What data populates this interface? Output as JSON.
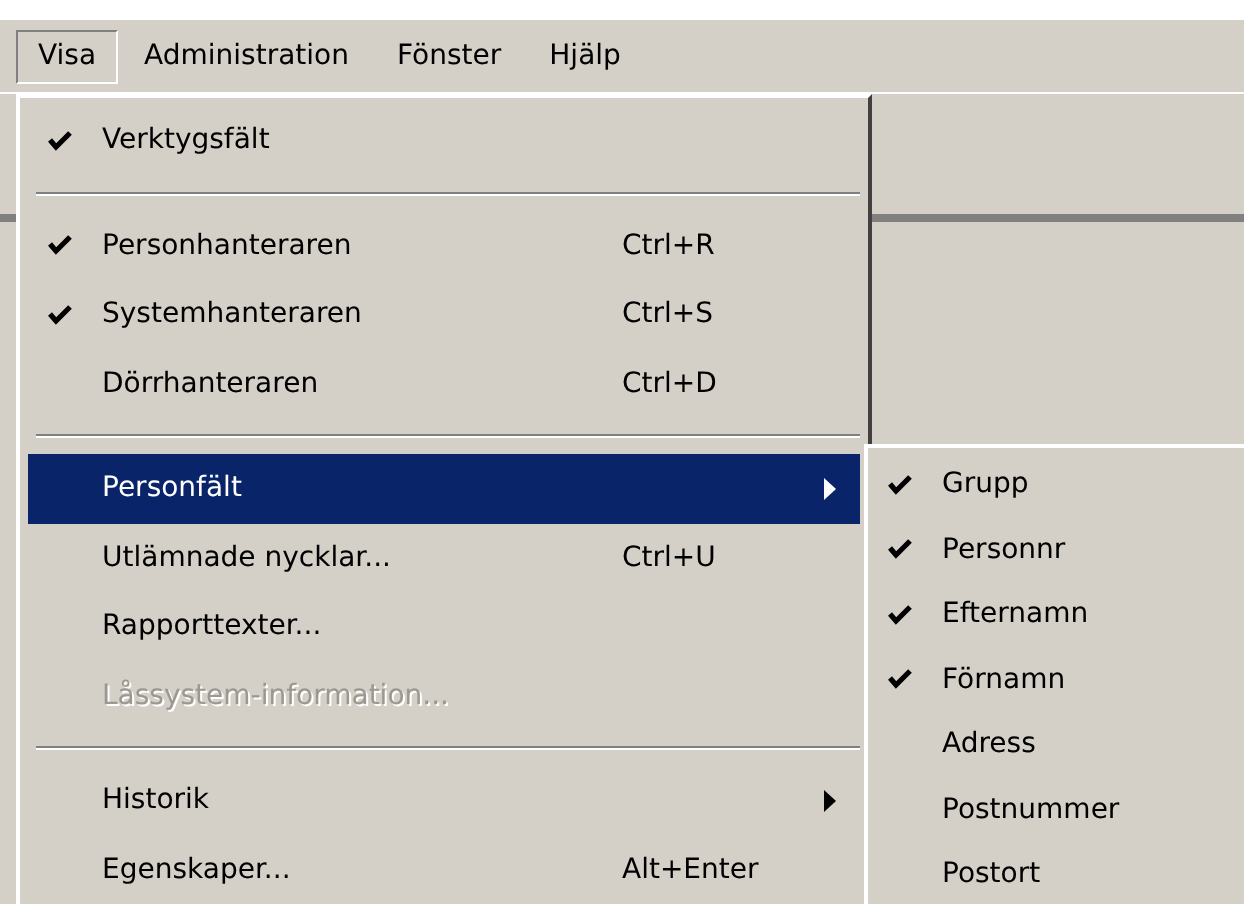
{
  "menubar": [
    {
      "label": "Visa",
      "selected": true
    },
    {
      "label": "Administration",
      "selected": false
    },
    {
      "label": "Fönster",
      "selected": false
    },
    {
      "label": "Hjälp",
      "selected": false
    }
  ],
  "menu": [
    {
      "kind": "item",
      "label": "Verktygsfält",
      "checked": true,
      "selected": false,
      "disabled": false,
      "submenu": false
    },
    {
      "kind": "separator"
    },
    {
      "kind": "item",
      "label": "Personhanteraren",
      "shortcut": "Ctrl+R",
      "checked": true,
      "selected": false,
      "disabled": false,
      "submenu": false
    },
    {
      "kind": "item",
      "label": "Systemhanteraren",
      "shortcut": "Ctrl+S",
      "checked": true,
      "selected": false,
      "disabled": false,
      "submenu": false
    },
    {
      "kind": "item",
      "label": "Dörrhanteraren",
      "shortcut": "Ctrl+D",
      "checked": false,
      "selected": false,
      "disabled": false,
      "submenu": false
    },
    {
      "kind": "separator"
    },
    {
      "kind": "item",
      "label": "Personfält",
      "checked": false,
      "selected": true,
      "disabled": false,
      "submenu": true
    },
    {
      "kind": "item",
      "label": "Utlämnade nycklar...",
      "shortcut": "Ctrl+U",
      "checked": false,
      "selected": false,
      "disabled": false,
      "submenu": false
    },
    {
      "kind": "item",
      "label": "Rapporttexter...",
      "checked": false,
      "selected": false,
      "disabled": false,
      "submenu": false
    },
    {
      "kind": "item",
      "label": "Låssystem-information...",
      "checked": false,
      "selected": false,
      "disabled": true,
      "submenu": false
    },
    {
      "kind": "separator"
    },
    {
      "kind": "item",
      "label": "Historik",
      "checked": false,
      "selected": false,
      "disabled": false,
      "submenu": true
    },
    {
      "kind": "item",
      "label": "Egenskaper...",
      "shortcut": "Alt+Enter",
      "checked": false,
      "selected": false,
      "disabled": false,
      "submenu": false
    }
  ],
  "submenu": [
    {
      "label": "Grupp",
      "checked": true
    },
    {
      "label": "Personnr",
      "checked": true
    },
    {
      "label": "Efternamn",
      "checked": true
    },
    {
      "label": "Förnamn",
      "checked": true
    },
    {
      "label": "Adress",
      "checked": false
    },
    {
      "label": "Postnummer",
      "checked": false
    },
    {
      "label": "Postort",
      "checked": false
    }
  ]
}
